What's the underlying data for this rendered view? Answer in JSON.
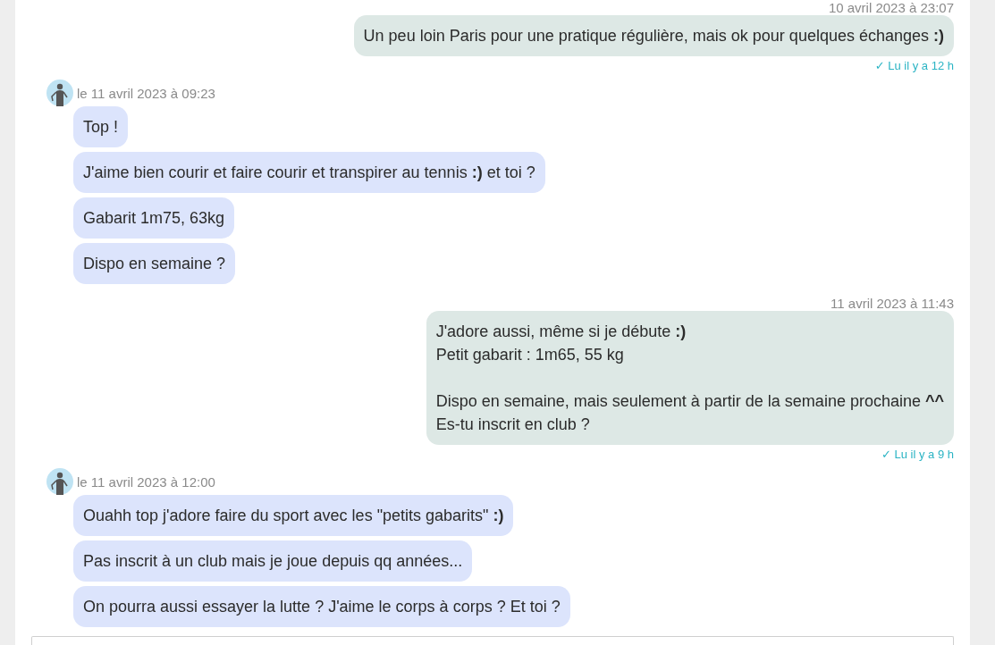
{
  "messages": [
    {
      "kind": "sent",
      "time": "10 avril 2023 à 23:07",
      "bubbles": [
        "Un peu loin Paris pour une pratique régulière, mais ok pour quelques échanges **:)**"
      ],
      "receipt": "✓ Lu il y a 12 h"
    },
    {
      "kind": "received",
      "time": "le 11 avril 2023 à 09:23",
      "bubbles": [
        "Top !",
        "J'aime bien courir et faire courir et transpirer au tennis **:)** et toi ?",
        "Gabarit 1m75, 63kg",
        "Dispo en semaine ?"
      ]
    },
    {
      "kind": "sent",
      "time": "11 avril 2023 à 11:43",
      "bubbles": [
        "J'adore aussi, même si je débute **:)**\nPetit gabarit : 1m65, 55 kg\n\nDispo en semaine, mais seulement à partir de la semaine prochaine **^^**\nEs-tu inscrit en club ?"
      ],
      "receipt": "✓ Lu il y a 9 h"
    },
    {
      "kind": "received",
      "time": "le 11 avril 2023 à 12:00",
      "bubbles": [
        "Ouahh top j'adore faire du sport avec les \"petits gabarits\" **:)**",
        "Pas inscrit à un club mais je joue depuis qq années...",
        "On pourra aussi essayer la lutte ? J'aime le corps à corps ? Et toi ?"
      ]
    }
  ]
}
